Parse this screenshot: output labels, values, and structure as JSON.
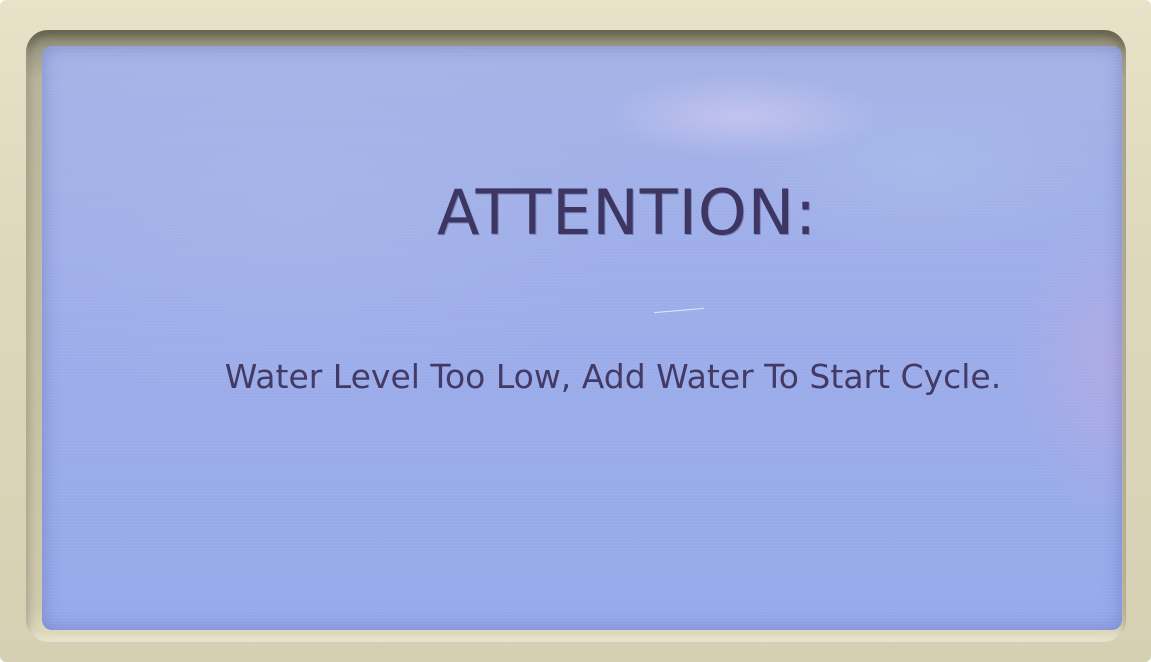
{
  "display": {
    "heading": "ATTENTION:",
    "message": "Water Level Too Low, Add Water To Start Cycle."
  },
  "colors": {
    "screen_backlight": "#9dadea",
    "text": "#3d3562",
    "bezel": "#ddd8bc"
  }
}
